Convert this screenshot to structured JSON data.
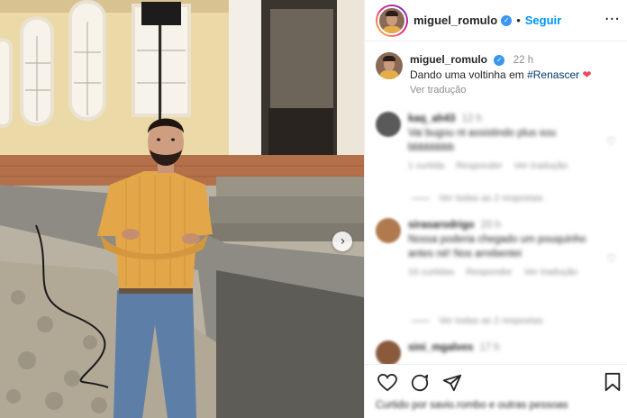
{
  "post": {
    "username": "miguel_romulo",
    "follow_label": "Seguir",
    "more_icon": "more-horizontal-icon",
    "verified_icon": "verified-badge-icon"
  },
  "caption": {
    "username": "miguel_romulo",
    "time": "22 h",
    "text_before": "Dando uma voltinha em ",
    "hashtag": "#Renascer",
    "emoji": "❤",
    "translate_label": "Ver tradução"
  },
  "comments": [
    {
      "username": "kaq_ah43",
      "time": "12 h",
      "text": "Vai bugou nt assistindo plus sou bbbbbbbb",
      "likes": "1 curtida",
      "reply": "Responder",
      "translate": "Ver tradução",
      "view_replies": "Ver todas as 2 respostas",
      "avatar_color": "#5a5a5a"
    },
    {
      "username": "sirasarodrigo",
      "time": "20 h",
      "text": "Nossa poderia chegado um pouquinho antes né! Nos arrebentei",
      "likes": "16 curtidas",
      "reply": "Responder",
      "translate": "Ver tradução",
      "view_replies": "Ver todas as 2 respostas",
      "avatar_color": "#b07a4e"
    },
    {
      "username": "sini_mgalves",
      "time": "17 h",
      "avatar_color": "#8a5a3c"
    }
  ],
  "footer": {
    "likes_text": "Curtido por savio.rombo e outras pessoas"
  },
  "colors": {
    "accent": "#0095f6",
    "heart": "#ed4956",
    "shirt": "#e6ac4a"
  }
}
